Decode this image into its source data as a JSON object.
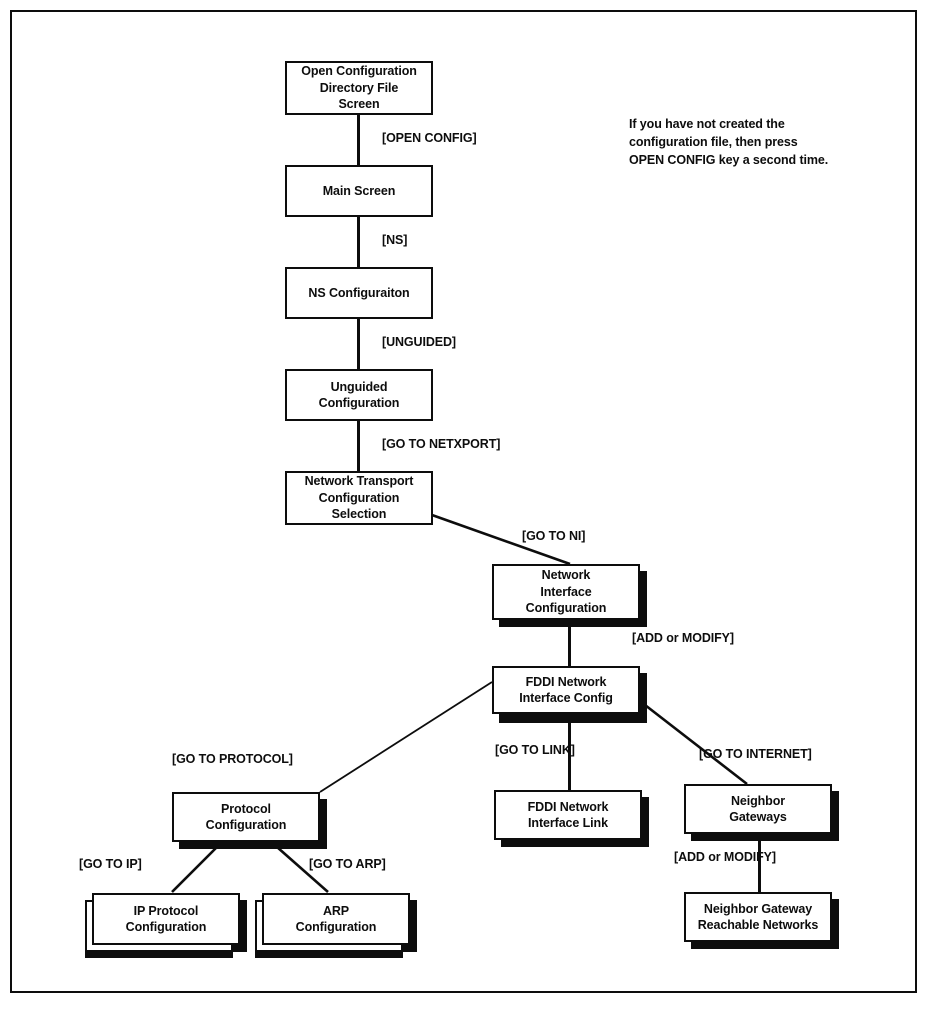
{
  "diagram": {
    "title": "Network Transport / Network Interface configuration screen flow",
    "frame_color": "#0d0d0d",
    "background": "#ffffff",
    "nodes": [
      {
        "id": "open_config_dir",
        "lines": [
          "Open Configuration",
          "Directory File",
          "Screen"
        ],
        "shadow": "none"
      },
      {
        "id": "main_screen",
        "lines": [
          "Main Screen"
        ],
        "shadow": "none"
      },
      {
        "id": "ns_config",
        "lines": [
          "NS Configuraiton"
        ],
        "shadow": "none"
      },
      {
        "id": "unguided_config",
        "lines": [
          "Unguided Configuration"
        ],
        "shadow": "none"
      },
      {
        "id": "net_transport",
        "lines": [
          "Network Transport",
          "Configuration",
          "Selection"
        ],
        "shadow": "none"
      },
      {
        "id": "net_interface",
        "lines": [
          "Network",
          "Interface",
          "Configuration"
        ],
        "shadow": "drop"
      },
      {
        "id": "fddi_ni_config",
        "lines": [
          "FDDI Network",
          "Interface Config"
        ],
        "shadow": "drop"
      },
      {
        "id": "protocol_config",
        "lines": [
          "Protocol",
          "Configuration"
        ],
        "shadow": "drop"
      },
      {
        "id": "fddi_ni_link",
        "lines": [
          "FDDI Network",
          "Interface Link"
        ],
        "shadow": "drop"
      },
      {
        "id": "neighbor_gateways",
        "lines": [
          "Neighbor",
          "Gateways"
        ],
        "shadow": "drop"
      },
      {
        "id": "ip_protocol",
        "lines": [
          "IP Protocol",
          "Configuration"
        ],
        "shadow": "stacked"
      },
      {
        "id": "arp_config",
        "lines": [
          "ARP",
          "Configuration"
        ],
        "shadow": "stacked"
      },
      {
        "id": "ngw_reachable",
        "lines": [
          "Neighbor Gateway",
          "Reachable Networks"
        ],
        "shadow": "drop"
      }
    ],
    "edges": [
      {
        "id": "e_open_config",
        "label": "[OPEN CONFIG]",
        "from": "open_config_dir",
        "to": "main_screen"
      },
      {
        "id": "e_ns",
        "label": "[NS]",
        "from": "main_screen",
        "to": "ns_config"
      },
      {
        "id": "e_unguided",
        "label": "[UNGUIDED]",
        "from": "ns_config",
        "to": "unguided_config"
      },
      {
        "id": "e_netxport",
        "label": "[GO TO NETXPORT]",
        "from": "unguided_config",
        "to": "net_transport"
      },
      {
        "id": "e_ni",
        "label": "[GO TO NI]",
        "from": "net_transport",
        "to": "net_interface"
      },
      {
        "id": "e_add_modify_ni",
        "label": "[ADD or MODIFY]",
        "from": "net_interface",
        "to": "fddi_ni_config"
      },
      {
        "id": "e_protocol",
        "label": "[GO TO PROTOCOL]",
        "from": "fddi_ni_config",
        "to": "protocol_config"
      },
      {
        "id": "e_link",
        "label": "[GO TO LINK]",
        "from": "fddi_ni_config",
        "to": "fddi_ni_link"
      },
      {
        "id": "e_internet",
        "label": "[GO TO INTERNET]",
        "from": "fddi_ni_config",
        "to": "neighbor_gateways"
      },
      {
        "id": "e_ip",
        "label": "[GO TO IP]",
        "from": "protocol_config",
        "to": "ip_protocol"
      },
      {
        "id": "e_arp",
        "label": "[GO TO ARP]",
        "from": "protocol_config",
        "to": "arp_config"
      },
      {
        "id": "e_add_modify_gw",
        "label": "[ADD or MODIFY]",
        "from": "neighbor_gateways",
        "to": "ngw_reachable"
      }
    ],
    "note": {
      "id": "open_config_note",
      "lines": [
        "If you have not created the",
        "configuration file, then press",
        "OPEN CONFIG key a second time."
      ]
    }
  }
}
